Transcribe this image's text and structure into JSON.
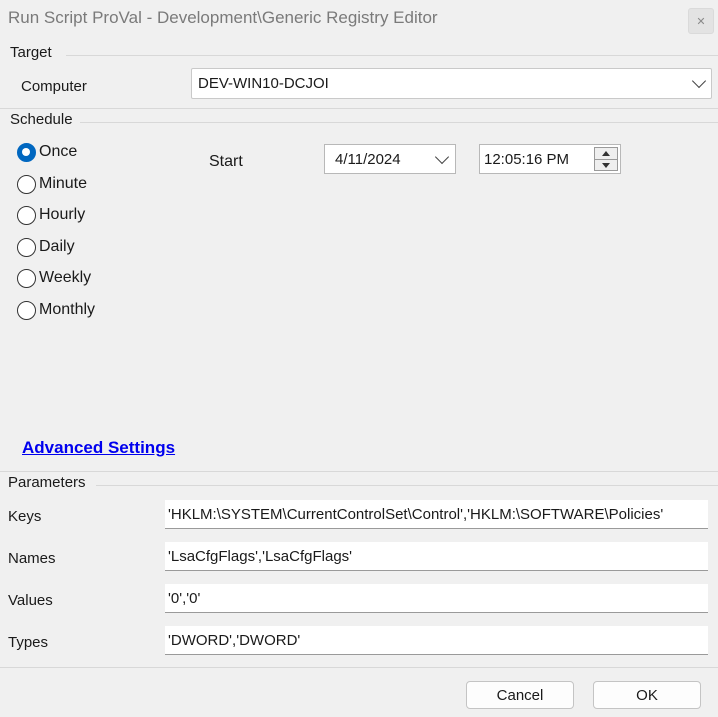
{
  "window": {
    "title": "Run Script ProVal - Development\\Generic Registry Editor",
    "close_glyph": "✕"
  },
  "target": {
    "section_label": "Target",
    "computer_label": "Computer",
    "computer_value": "DEV-WIN10-DCJOI"
  },
  "schedule": {
    "section_label": "Schedule",
    "options": [
      "Once",
      "Minute",
      "Hourly",
      "Daily",
      "Weekly",
      "Monthly"
    ],
    "selected": "Once",
    "start_label": "Start",
    "date_value": "4/11/2024",
    "time_value": "12:05:16 PM"
  },
  "advanced_settings_label": "Advanced Settings",
  "parameters": {
    "section_label": "Parameters",
    "fields": [
      {
        "label": "Keys",
        "value": "'HKLM:\\SYSTEM\\CurrentControlSet\\Control','HKLM:\\SOFTWARE\\Policies'"
      },
      {
        "label": "Names",
        "value": "'LsaCfgFlags','LsaCfgFlags'"
      },
      {
        "label": "Values",
        "value": "'0','0'"
      },
      {
        "label": "Types",
        "value": "'DWORD','DWORD'"
      }
    ]
  },
  "buttons": {
    "cancel": "Cancel",
    "ok": "OK"
  },
  "colors": {
    "accent": "#0067c0",
    "link": "#0000ee",
    "background": "#f0f0f0"
  },
  "icons": [
    "close-icon",
    "chevron-down-icon",
    "spin-up-icon",
    "spin-down-icon"
  ]
}
